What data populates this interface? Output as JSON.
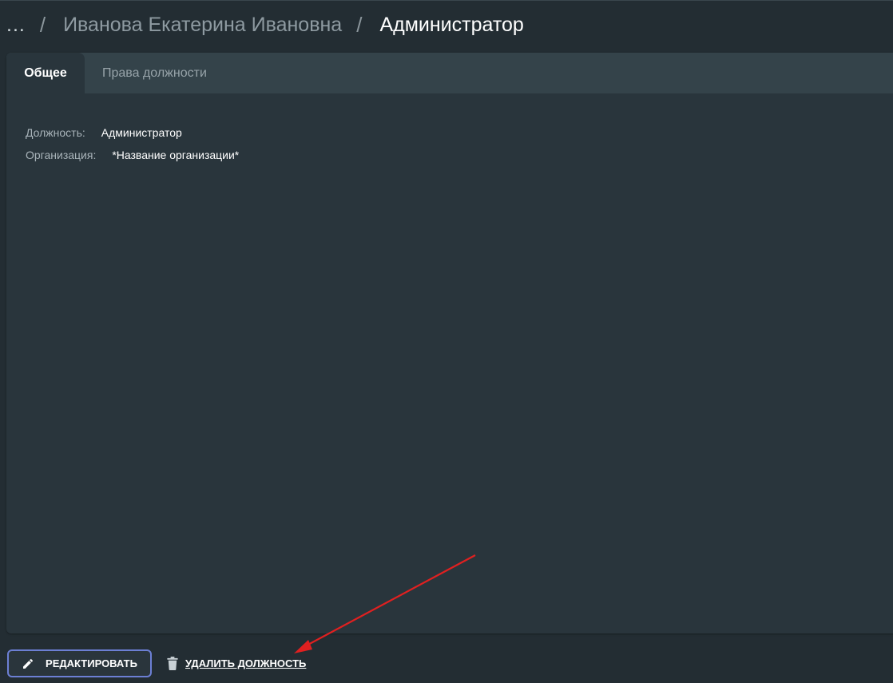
{
  "breadcrumb": {
    "more": "...",
    "separator": "/",
    "items": [
      "Иванова Екатерина Ивановна",
      "Администратор"
    ]
  },
  "tabs": [
    {
      "label": "Общее",
      "active": true
    },
    {
      "label": "Права должности",
      "active": false
    }
  ],
  "info": {
    "position_label": "Должность:",
    "position_value": "Администратор",
    "organization_label": "Организация:",
    "organization_value": "*Название организации*"
  },
  "actions": {
    "edit_label": "РЕДАКТИРОВАТЬ",
    "delete_label": "УДАЛИТЬ ДОЛЖНОСТЬ"
  },
  "icons": {
    "edit": "pencil-icon",
    "delete": "trash-icon"
  },
  "colors": {
    "background": "#232d33",
    "panel": "#29353c",
    "tabbar": "#34434a",
    "edit_border": "#6c7fd4",
    "annotation_arrow": "#e02020"
  }
}
